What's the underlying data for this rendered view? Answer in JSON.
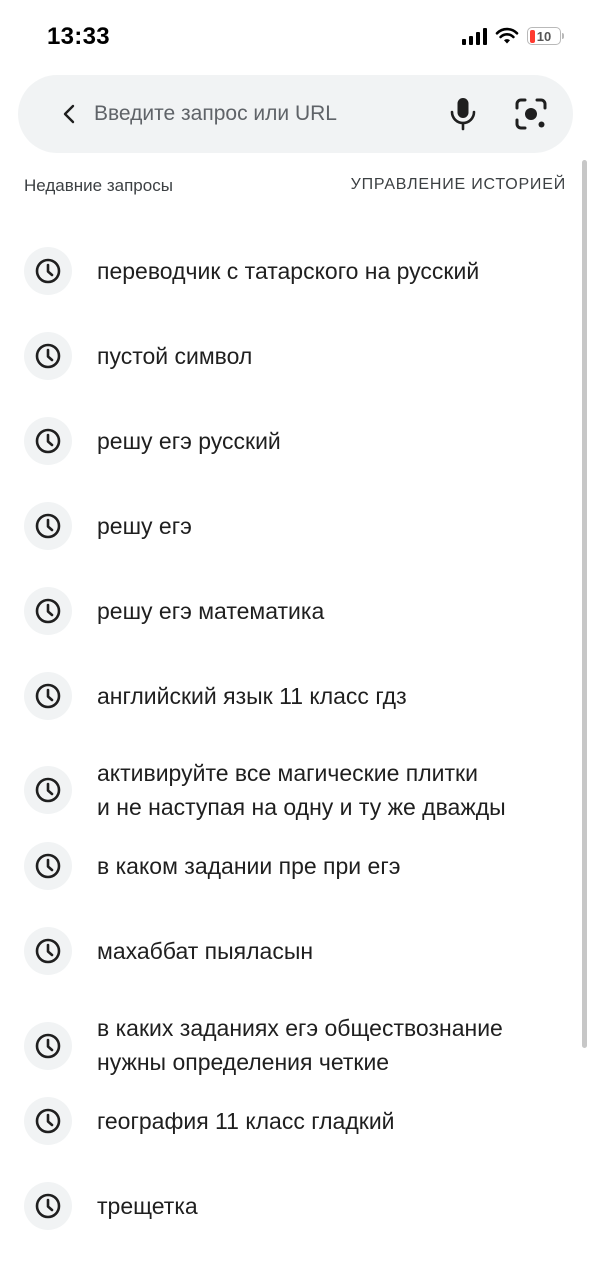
{
  "status_bar": {
    "time": "13:33",
    "battery_level": "10",
    "icons": [
      "cellular-signal-icon",
      "wifi-icon",
      "battery-icon"
    ]
  },
  "search": {
    "placeholder": "Введите запрос или URL",
    "value": "",
    "icons": {
      "back": "back-arrow-icon",
      "mic": "microphone-icon",
      "lens": "camera-lens-icon"
    }
  },
  "recent": {
    "title": "Недавние запросы",
    "manage_label": "УПРАВЛЕНИЕ ИСТОРИЕЙ",
    "items": [
      {
        "lines": [
          "переводчик с татарского на русский"
        ]
      },
      {
        "lines": [
          "пустой символ"
        ]
      },
      {
        "lines": [
          "решу егэ русский"
        ]
      },
      {
        "lines": [
          "решу егэ"
        ]
      },
      {
        "lines": [
          "решу егэ математика"
        ]
      },
      {
        "lines": [
          "английский язык 11 класс гдз"
        ]
      },
      {
        "lines": [
          "активируйте все магические плитки",
          "и не наступая на одну и ту же дважды"
        ]
      },
      {
        "lines": [
          "в каком задании пре при егэ"
        ]
      },
      {
        "lines": [
          "махаббат пыяласын"
        ]
      },
      {
        "lines": [
          "в каких заданиях егэ обществознание",
          "нужны определения четкие"
        ]
      },
      {
        "lines": [
          "география 11 класс гладкий"
        ]
      },
      {
        "lines": [
          "трещетка"
        ]
      }
    ],
    "item_icon": "history-clock-icon"
  },
  "colors": {
    "search_bg": "#f1f3f4",
    "text": "#1f1f1f",
    "secondary_text": "#3c4043",
    "battery_low": "#ff3b30"
  }
}
